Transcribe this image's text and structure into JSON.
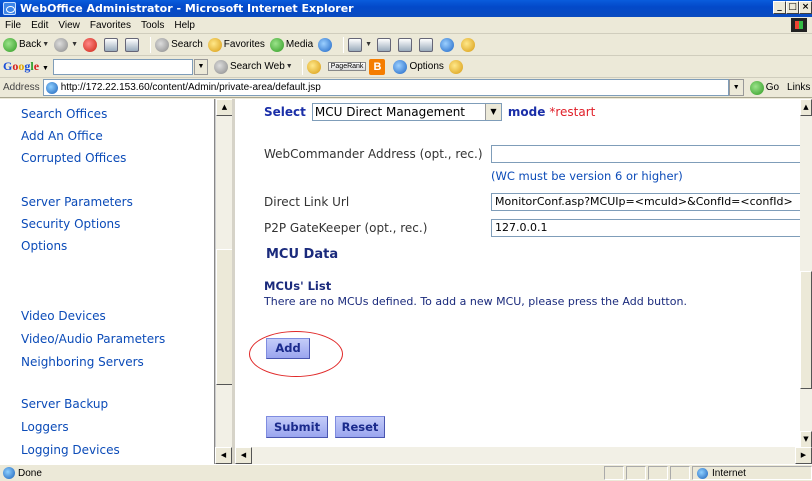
{
  "window": {
    "title": "WebOffice Administrator - Microsoft Internet Explorer",
    "controls": [
      "_",
      "□",
      "×"
    ]
  },
  "menu": [
    "File",
    "Edit",
    "View",
    "Favorites",
    "Tools",
    "Help"
  ],
  "toolbar": {
    "back": "Back",
    "search": "Search",
    "favorites": "Favorites",
    "media": "Media"
  },
  "googlebar": {
    "search_web": "Search Web",
    "pagerank": "PageRank",
    "options": "Options"
  },
  "address": {
    "label": "Address",
    "url": "http://172.22.153.60/content/Admin/private-area/default.jsp",
    "go": "Go",
    "links": "Links"
  },
  "nav": {
    "group1": [
      "Search Offices",
      "Add An Office",
      "Corrupted Offices"
    ],
    "group2": [
      "Server Parameters",
      "Security Options",
      "Options"
    ],
    "group3": [
      "Video Devices",
      "Video/Audio Parameters",
      "Neighboring Servers"
    ],
    "group4": [
      "Server Backup",
      "Loggers",
      "Logging Devices"
    ]
  },
  "main": {
    "select_label": "Select",
    "mode_value": "MCU Direct Management",
    "mode_label": "mode",
    "restart_note": "*restart",
    "webcommander_label": "WebCommander Address (opt., rec.)",
    "webcommander_value": "",
    "wc_hint": "(WC must be version 6 or higher)",
    "direct_link_label": "Direct Link Url",
    "direct_link_value": "MonitorConf.asp?MCUIp=<mcuId>&ConfId=<confId>",
    "p2p_label": "P2P GateKeeper (opt., rec.)",
    "p2p_value": "127.0.0.1",
    "mcu_data_title": "MCU Data",
    "mcus_list_title": "MCUs' List",
    "no_mcus_text": "There are no MCUs defined. To add a new MCU, please press the Add button.",
    "add_button": "Add",
    "submit_button": "Submit",
    "reset_button": "Reset"
  },
  "status": {
    "text": "Done",
    "zone": "Internet"
  }
}
